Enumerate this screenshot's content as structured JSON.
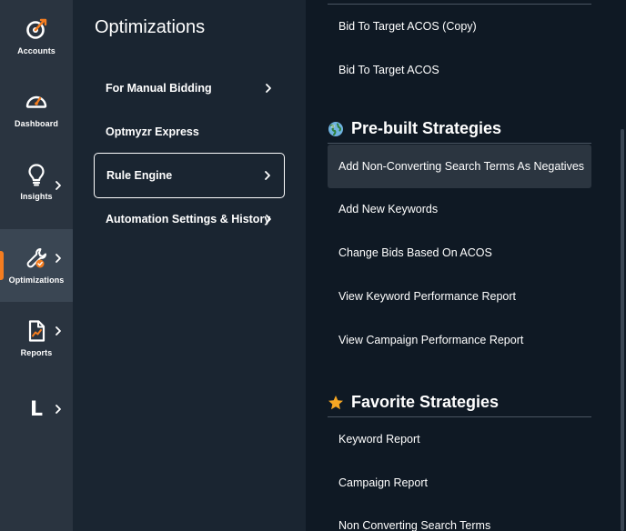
{
  "rail": {
    "items": [
      {
        "label": "Accounts",
        "icon": "target-icon"
      },
      {
        "label": "Dashboard",
        "icon": "speedometer-icon"
      },
      {
        "label": "Insights",
        "icon": "lightbulb-icon"
      },
      {
        "label": "Optimizations",
        "icon": "wrench-icon"
      },
      {
        "label": "Reports",
        "icon": "report-icon"
      },
      {
        "label": "",
        "letter": "L"
      }
    ],
    "active": "Optimizations",
    "accent": "#f47d20"
  },
  "panel": {
    "title": "Optimizations",
    "items": [
      {
        "label": "For Manual Bidding"
      },
      {
        "label": "Optmyzr Express"
      },
      {
        "label": "Rule Engine"
      },
      {
        "label": "Automation Settings & History"
      }
    ]
  },
  "content": {
    "top_items": [
      {
        "label": "Bid To Target ACOS (Copy)"
      },
      {
        "label": "Bid To Target ACOS"
      }
    ],
    "prebuilt": {
      "title": "Pre-built Strategies",
      "icon": "globe-icon",
      "items": [
        {
          "label": "Add Non-Converting Search Terms As Negatives"
        },
        {
          "label": "Add New Keywords"
        },
        {
          "label": "Change Bids Based On ACOS"
        },
        {
          "label": "View Keyword Performance Report"
        },
        {
          "label": "View Campaign Performance Report"
        }
      ]
    },
    "favorites": {
      "title": "Favorite Strategies",
      "icon": "star-icon",
      "items": [
        {
          "label": "Keyword Report"
        },
        {
          "label": "Campaign Report"
        },
        {
          "label": "Non Converting Search Terms"
        }
      ]
    }
  }
}
